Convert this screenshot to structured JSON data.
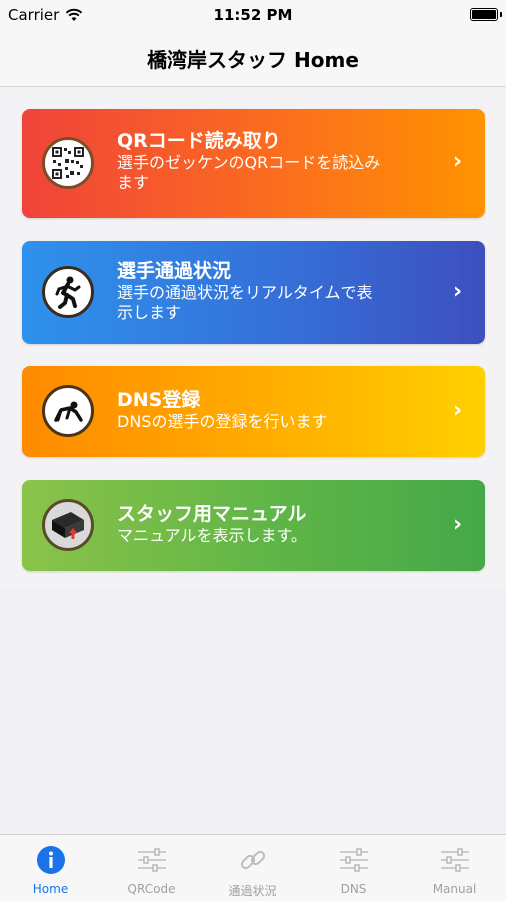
{
  "status_bar": {
    "carrier": "Carrier",
    "time": "11:52 PM"
  },
  "nav": {
    "title": "橋湾岸スタッフ Home"
  },
  "cards": [
    {
      "title": "QRコード読み取り",
      "desc_line1": "選手のゼッケンのQRコードを読込み",
      "desc_line2": "ます",
      "icon": "qr-code-icon"
    },
    {
      "title": "選手通過状況",
      "desc_line1": "選手の通過状況をリアルタイムで表",
      "desc_line2": "示します",
      "icon": "runner-icon"
    },
    {
      "title": "DNS登録",
      "desc_line1": "DNSの選手の登録を行います",
      "icon": "fallen-runner-icon"
    },
    {
      "title": "スタッフ用マニュアル",
      "desc_line1": "マニュアルを表示します。",
      "icon": "manual-book-icon"
    }
  ],
  "tabs": [
    {
      "label": "Home",
      "icon": "info-icon",
      "active": true
    },
    {
      "label": "QRCode",
      "icon": "sliders-icon"
    },
    {
      "label": "通過状況",
      "icon": "link-icon"
    },
    {
      "label": "DNS",
      "icon": "sliders-icon"
    },
    {
      "label": "Manual",
      "icon": "sliders-icon"
    }
  ],
  "colors": {
    "accent": "#1a73e8",
    "inactive": "#a0a0a0"
  }
}
